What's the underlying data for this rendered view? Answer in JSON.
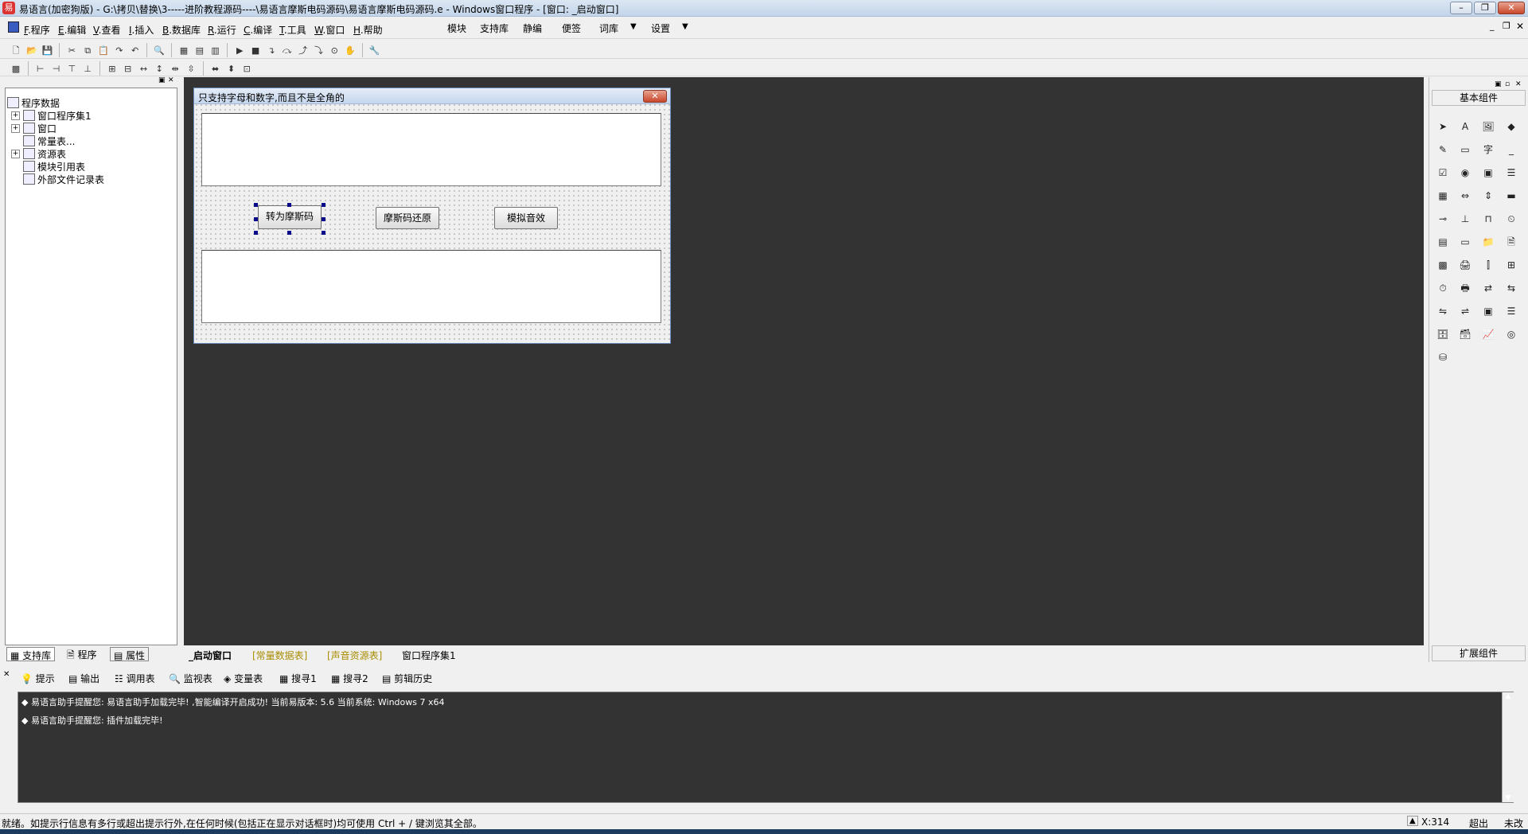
{
  "window": {
    "title": "易语言(加密狗版) - G:\\拷贝\\替换\\3-----进阶教程源码----\\易语言摩斯电码源码\\易语言摩斯电码源码.e - Windows窗口程序 - [窗口: _启动窗口]",
    "icon": "app-logo-icon"
  },
  "menu": {
    "items": [
      {
        "key": "F",
        "label": ".程序"
      },
      {
        "key": "E",
        "label": ".编辑"
      },
      {
        "key": "V",
        "label": ".查看"
      },
      {
        "key": "I",
        "label": ".插入"
      },
      {
        "key": "B",
        "label": ".数据库"
      },
      {
        "key": "R",
        "label": ".运行"
      },
      {
        "key": "C",
        "label": ".编译"
      },
      {
        "key": "T",
        "label": ".工具"
      },
      {
        "key": "W",
        "label": ".窗口"
      },
      {
        "key": "H",
        "label": ".帮助"
      }
    ],
    "extras": [
      "模块",
      "支持库",
      "静编",
      "便签",
      "词库",
      "设置"
    ]
  },
  "tree": {
    "root": "程序数据",
    "items": [
      "窗口程序集1",
      "窗口",
      "常量表...",
      "资源表",
      "模块引用表",
      "外部文件记录表"
    ]
  },
  "left_tabs": [
    "支持库",
    "程序",
    "属性"
  ],
  "form": {
    "title": "只支持字母和数字,而且不是全角的",
    "buttons": [
      "转为摩斯码",
      "摩斯码还原",
      "模拟音效"
    ]
  },
  "design_tabs": [
    "_启动窗口",
    "[常量数据表]",
    "[声音资源表]",
    "窗口程序集1"
  ],
  "components": {
    "basic_title": "基本组件",
    "ext_title": "扩展组件"
  },
  "output_tabs": [
    "提示",
    "输出",
    "调用表",
    "监视表",
    "变量表",
    "搜寻1",
    "搜寻2",
    "剪辑历史"
  ],
  "output_lines": [
    "易语言助手提醒您: 易语言助手加载完毕! ,智能编译开启成功! 当前易版本: 5.6 当前系统: Windows 7 x64",
    "易语言助手提醒您: 插件加载完毕!"
  ],
  "status": {
    "message": "就绪。如提示行信息有多行或超出提示行外,在任何时候(包括正在显示对话框时)均可使用 Ctrl + / 键浏览其全部。",
    "coord": "X:314",
    "mode1": "超出",
    "mode2": "未改"
  }
}
